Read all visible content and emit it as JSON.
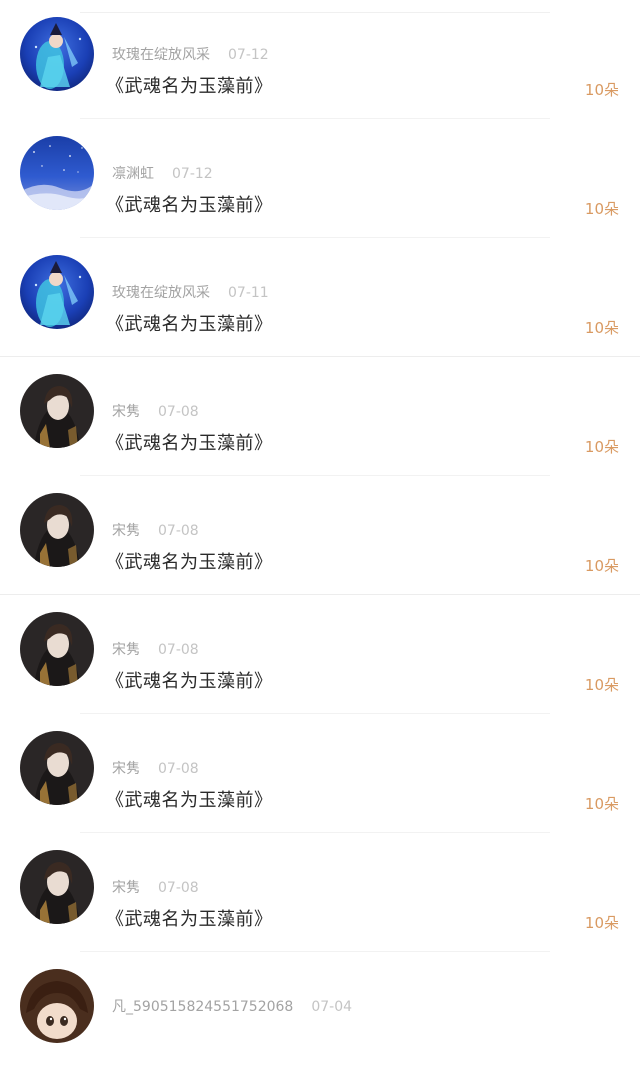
{
  "comments": [
    {
      "name": "玫瑰在绽放风采",
      "date": "07-12",
      "text": "《武魂名为玉藻前》",
      "count": "10朵",
      "avatar": "blue-dancer-icon"
    },
    {
      "name": "凛渊虹",
      "date": "07-12",
      "text": "《武魂名为玉藻前》",
      "count": "10朵",
      "avatar": "starry-sky-icon"
    },
    {
      "name": "玫瑰在绽放风采",
      "date": "07-11",
      "text": "《武魂名为玉藻前》",
      "count": "10朵",
      "avatar": "blue-dancer-icon"
    },
    {
      "name": "宋隽",
      "date": "07-08",
      "text": "《武魂名为玉藻前》",
      "count": "10朵",
      "avatar": "portrait-icon"
    },
    {
      "name": "宋隽",
      "date": "07-08",
      "text": "《武魂名为玉藻前》",
      "count": "10朵",
      "avatar": "portrait-icon"
    },
    {
      "name": "宋隽",
      "date": "07-08",
      "text": "《武魂名为玉藻前》",
      "count": "10朵",
      "avatar": "portrait-icon"
    },
    {
      "name": "宋隽",
      "date": "07-08",
      "text": "《武魂名为玉藻前》",
      "count": "10朵",
      "avatar": "portrait-icon"
    },
    {
      "name": "宋隽",
      "date": "07-08",
      "text": "《武魂名为玉藻前》",
      "count": "10朵",
      "avatar": "portrait-icon"
    },
    {
      "name": "凡_590515824551752068",
      "date": "07-04",
      "text": "",
      "count": "",
      "avatar": "anime-girl-icon"
    }
  ],
  "colors": {
    "accent": "#d99a62",
    "name_text": "#a3a3a3",
    "date_text": "#c4c4c4",
    "body_text": "#2b2b2b"
  }
}
